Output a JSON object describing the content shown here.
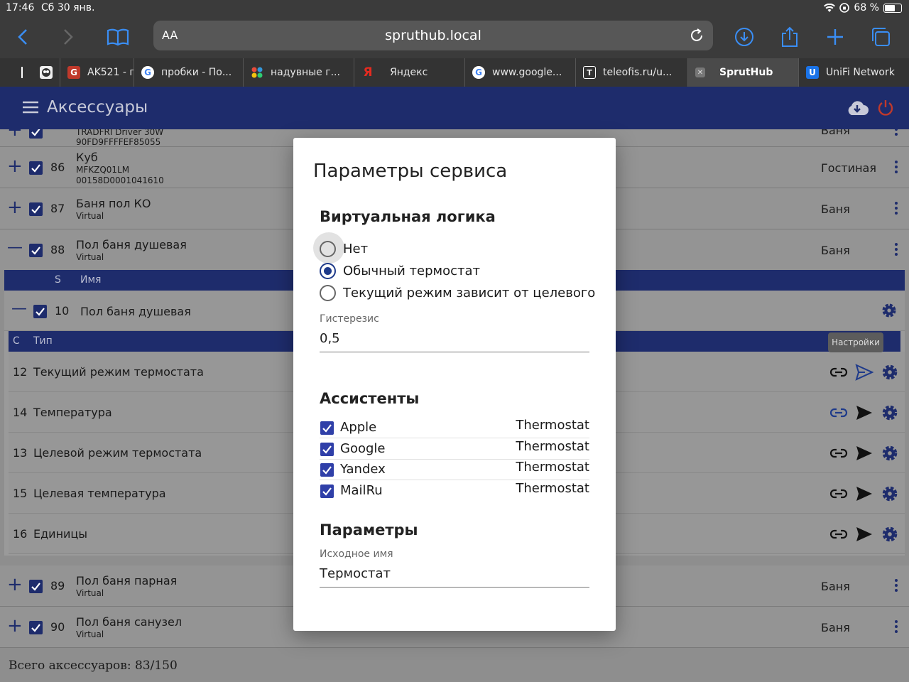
{
  "status": {
    "time": "17:46",
    "date": "Сб 30 янв.",
    "battery": "68 %",
    "battery_level": 0.68
  },
  "browser": {
    "aa": "AA",
    "url": "spruthub.local",
    "tabs": [
      {
        "label": "",
        "icon": "tab-icon"
      },
      {
        "label": "AK521 - г",
        "icon": "ak-icon",
        "color": "#c0392b"
      },
      {
        "label": "пробки - По...",
        "icon": "google-icon"
      },
      {
        "label": "надувные г...",
        "icon": "dots-logo-icon"
      },
      {
        "label": "Яндекс",
        "icon": "yandex-icon"
      },
      {
        "label": "www.google...",
        "icon": "google-icon"
      },
      {
        "label": "teleofis.ru/u...",
        "icon": "t-icon"
      },
      {
        "label": "SprutHub",
        "icon": "close-tab-icon",
        "active": true
      },
      {
        "label": "UniFi Network",
        "icon": "unifi-icon"
      }
    ]
  },
  "app": {
    "title": "Аксессуары",
    "accent": "#1e2c6c"
  },
  "accessories": [
    {
      "num": "",
      "name": "",
      "sub1": "TRADFRI Driver 30W",
      "sub2": "90FD9FFFFEF85055",
      "room": "Ваня",
      "toggle": "+"
    },
    {
      "num": "86",
      "name": "Куб",
      "sub1": "MFKZQ01LM",
      "sub2": "00158D0001041610",
      "room": "Гостиная",
      "toggle": "+"
    },
    {
      "num": "87",
      "name": "Баня пол КО",
      "sub1": "Virtual",
      "sub2": "",
      "room": "Баня",
      "toggle": "+"
    },
    {
      "num": "88",
      "name": "Пол баня душевая",
      "sub1": "Virtual",
      "sub2": "",
      "room": "Баня",
      "toggle": "—"
    }
  ],
  "services_header": {
    "s": "S",
    "name": "Имя"
  },
  "service": {
    "num": "10",
    "name": "Пол баня душевая",
    "toggle": "—"
  },
  "char_header": {
    "c": "С",
    "type": "Тип"
  },
  "tooltip": "Настройки",
  "characteristics": [
    {
      "num": "12",
      "name": "Текущий режим термостата"
    },
    {
      "num": "14",
      "name": "Температура"
    },
    {
      "num": "13",
      "name": "Целевой режим термостата"
    },
    {
      "num": "15",
      "name": "Целевая температура"
    },
    {
      "num": "16",
      "name": "Единицы"
    }
  ],
  "accessories_after": [
    {
      "num": "89",
      "name": "Пол баня парная",
      "sub1": "Virtual",
      "room": "Баня",
      "toggle": "+"
    },
    {
      "num": "90",
      "name": "Пол баня санузел",
      "sub1": "Virtual",
      "room": "Баня",
      "toggle": "+"
    }
  ],
  "footer": "Всего аксессуаров: 83/150",
  "dialog": {
    "title": "Параметры сервиса",
    "logic_title": "Виртуальная логика",
    "options": [
      "Нет",
      "Обычный термостат",
      "Текущий режим зависит от целевого"
    ],
    "selected": 1,
    "hysteresis_label": "Гистерезис",
    "hysteresis_value": "0,5",
    "assistants_title": "Ассистенты",
    "assistants": [
      {
        "name": "Apple",
        "value": "Thermostat"
      },
      {
        "name": "Google",
        "value": "Thermostat"
      },
      {
        "name": "Yandex",
        "value": "Thermostat"
      },
      {
        "name": "MailRu",
        "value": "Thermostat"
      }
    ],
    "params_title": "Параметры",
    "orig_name_label": "Исходное имя",
    "orig_name_value": "Термостат"
  }
}
